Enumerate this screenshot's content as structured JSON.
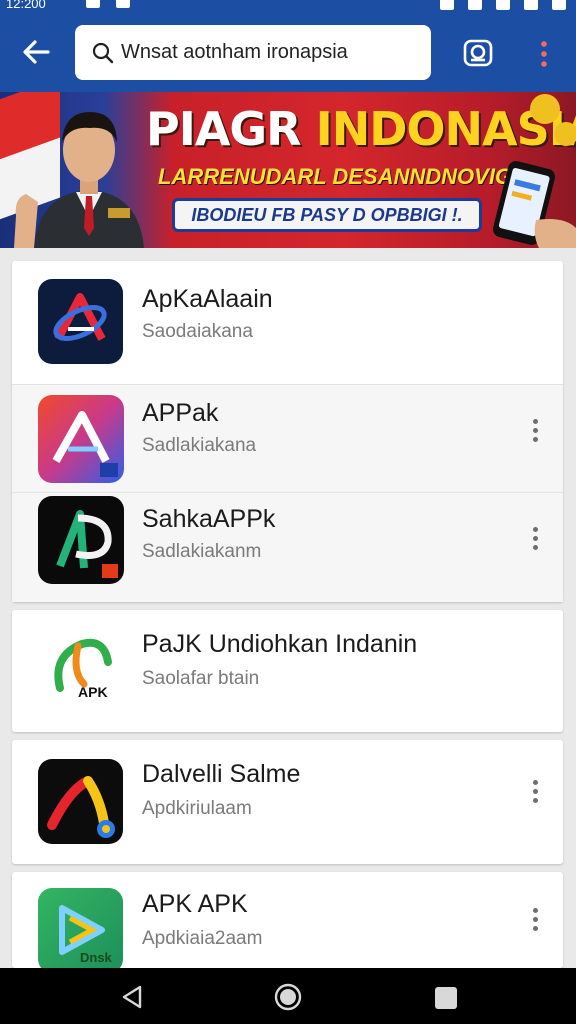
{
  "status_bar": {
    "time": "12:200"
  },
  "app_bar": {
    "search_text": "Wnsat aotnham ironapsia",
    "icons": [
      "back-arrow-icon",
      "search-icon",
      "lens-icon",
      "more-vert-icon"
    ]
  },
  "banner": {
    "title_white": "PIAGR ",
    "title_yellow": "INDONASIA",
    "subtitle": "LARRENUDARL DESANNDNOVIGH",
    "ribbon": "IBODIEU FB PASY D OPBBIGI !.",
    "colors": {
      "red": "#d4262c",
      "yellow": "#ffd21f",
      "blue": "#1d3c9a"
    }
  },
  "apps": [
    {
      "name": "ApKaAlaain",
      "subtitle": "Saodaiakana",
      "icon": "apk-red-blue-logo-icon",
      "menu": false
    },
    {
      "name": "APPak",
      "subtitle": "Sadlakiakana",
      "icon": "apk-gradient-a-logo-icon",
      "menu": true
    },
    {
      "name": "SahkaAPPk",
      "subtitle": "Sadlakiakanm",
      "icon": "apk-black-green-logo-icon",
      "menu": true
    },
    {
      "name": "PaJK Undiohkan Indanin",
      "subtitle": "Saolafar btain",
      "icon": "apk-green-orange-logo-icon",
      "menu": false
    },
    {
      "name": "Dalvelli Salme",
      "subtitle": "Apdkiriulaam",
      "icon": "apk-dark-swoosh-logo-icon",
      "menu": true
    },
    {
      "name": "APK APK",
      "subtitle": "Apdkiaia2aam",
      "icon": "apk-green-play-logo-icon",
      "menu": true
    }
  ],
  "apk_badge": "APK",
  "play_badge": "Dnsk",
  "nav_bar": {
    "icons": [
      "nav-back-icon",
      "nav-home-icon",
      "nav-recents-icon"
    ]
  }
}
